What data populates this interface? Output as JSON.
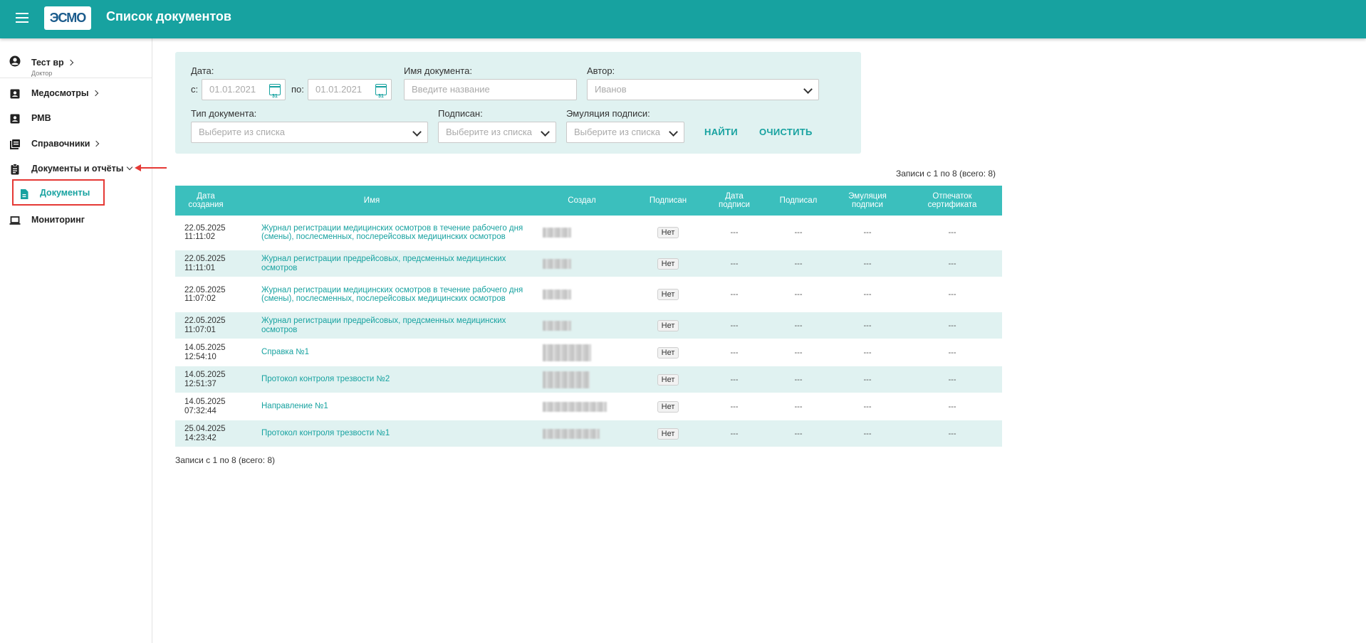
{
  "header": {
    "title": "Список документов",
    "logo_text": "ЭСМО"
  },
  "sidebar": {
    "user": {
      "name": "Тест вр",
      "role": "Доктор"
    },
    "items": [
      {
        "label": "Медосмотры",
        "icon": "person-badge-icon"
      },
      {
        "label": "РМВ",
        "icon": "person-badge-icon"
      },
      {
        "label": "Справочники",
        "icon": "book-icon"
      },
      {
        "label": "Документы и отчёты",
        "icon": "clipboard-icon"
      },
      {
        "label": "Мониторинг",
        "icon": "laptop-icon"
      }
    ],
    "sub_item": {
      "label": "Документы",
      "icon": "document-icon"
    }
  },
  "filters": {
    "date_label": "Дата:",
    "from_label": "с:",
    "to_label": "по:",
    "date_from_placeholder": "01.01.2021",
    "date_to_placeholder": "01.01.2021",
    "calendar_day": "31",
    "doc_name_label": "Имя документа:",
    "doc_name_placeholder": "Введите название",
    "author_label": "Автор:",
    "author_value": "Иванов",
    "doc_type_label": "Тип документа:",
    "doc_type_placeholder": "Выберите из списка",
    "signed_label": "Подписан:",
    "signed_placeholder": "Выберите из списка",
    "emulation_label": "Эмуляция подписи:",
    "emulation_placeholder": "Выберите из списка",
    "find_button": "НАЙТИ",
    "clear_button": "ОЧИСТИТЬ"
  },
  "records_text": "Записи с 1 по 8 (всего: 8)",
  "table": {
    "columns": [
      "Дата создания",
      "Имя",
      "Создал",
      "Подписан",
      "Дата подписи",
      "Подписал",
      "Эмуляция подписи",
      "Отпечаток сертификата"
    ],
    "rows": [
      {
        "date": "22.05.2025",
        "time": "11:11:02",
        "name": "Журнал регистрации медицинских осмотров в течение рабочего дня (смены), послесменных, послерейсовых медицинских осмотров",
        "signed": "Нет",
        "sign_date": "---",
        "signer": "---",
        "emulation": "---",
        "cert": "---"
      },
      {
        "date": "22.05.2025",
        "time": "11:11:01",
        "name": "Журнал регистрации предрейсовых, предсменных медицинских осмотров",
        "signed": "Нет",
        "sign_date": "---",
        "signer": "---",
        "emulation": "---",
        "cert": "---"
      },
      {
        "date": "22.05.2025",
        "time": "11:07:02",
        "name": "Журнал регистрации медицинских осмотров в течение рабочего дня (смены), послесменных, послерейсовых медицинских осмотров",
        "signed": "Нет",
        "sign_date": "---",
        "signer": "---",
        "emulation": "---",
        "cert": "---"
      },
      {
        "date": "22.05.2025",
        "time": "11:07:01",
        "name": "Журнал регистрации предрейсовых, предсменных медицинских осмотров",
        "signed": "Нет",
        "sign_date": "---",
        "signer": "---",
        "emulation": "---",
        "cert": "---"
      },
      {
        "date": "14.05.2025",
        "time": "12:54:10",
        "name": "Справка №1",
        "signed": "Нет",
        "sign_date": "---",
        "signer": "---",
        "emulation": "---",
        "cert": "---"
      },
      {
        "date": "14.05.2025",
        "time": "12:51:37",
        "name": "Протокол контроля трезвости №2",
        "signed": "Нет",
        "sign_date": "---",
        "signer": "---",
        "emulation": "---",
        "cert": "---"
      },
      {
        "date": "14.05.2025",
        "time": "07:32:44",
        "name": "Направление №1",
        "signed": "Нет",
        "sign_date": "---",
        "signer": "---",
        "emulation": "---",
        "cert": "---"
      },
      {
        "date": "25.04.2025",
        "time": "14:23:42",
        "name": "Протокол контроля трезвости №1",
        "signed": "Нет",
        "sign_date": "---",
        "signer": "---",
        "emulation": "---",
        "cert": "---"
      }
    ]
  },
  "colors": {
    "accent": "#17a2a0",
    "header_row": "#3bbfbd",
    "row_alt": "#e0f2f1",
    "highlight": "#e53935"
  }
}
